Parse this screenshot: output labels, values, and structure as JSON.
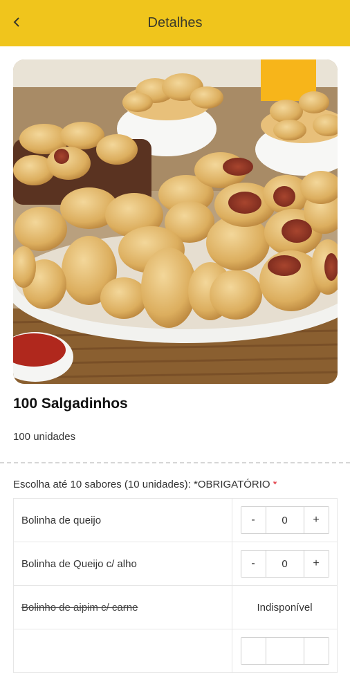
{
  "header": {
    "title": "Detalhes",
    "back_icon": "chevron-left-icon"
  },
  "product": {
    "title": "100 Salgadinhos",
    "description": "100 unidades",
    "image_alt": "Bandeja de salgadinhos fritos"
  },
  "flavors_section": {
    "label": "Escolha até 10 sabores (10 unidades): *OBRIGATÓRIO",
    "required_mark": "*",
    "options": [
      {
        "name": "Bolinha de queijo",
        "minus": "-",
        "quantity": "0",
        "plus": "+"
      },
      {
        "name": "Bolinha de Queijo c/ alho",
        "minus": "-",
        "quantity": "0",
        "plus": "+"
      },
      {
        "name": "Bolinho de aipim c/ carne",
        "status": "Indisponível"
      }
    ]
  },
  "colors": {
    "header_bg": "#f0c51c",
    "required": "#e0303a"
  }
}
